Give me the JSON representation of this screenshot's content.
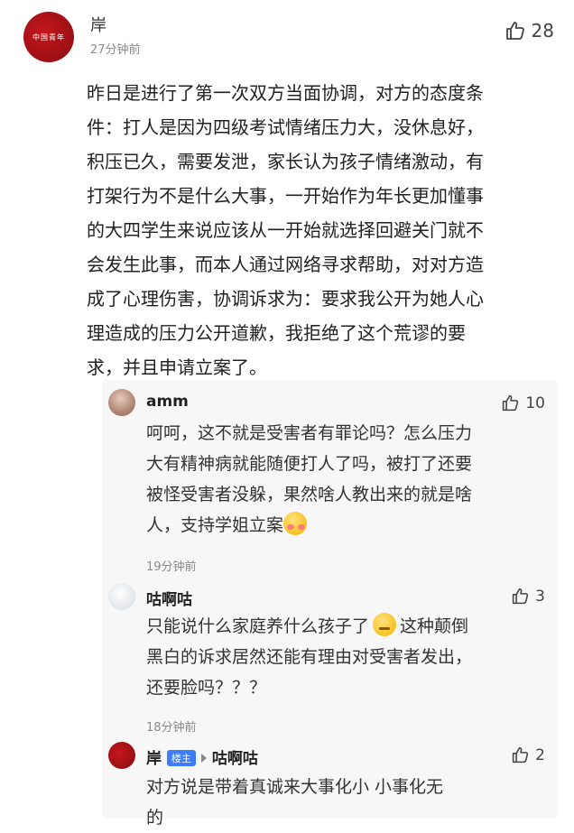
{
  "post": {
    "avatar_text": "中国青年",
    "author": "岸",
    "time": "27分钟前",
    "likes": "28",
    "lines": [
      "昨日是进行了第一次双方当面协调，对方的态度条",
      "件：打人是因为四级考试情绪压力大，没休息好，",
      "积压已久，需要发泄，家长认为孩子情绪激动，有",
      "打架行为不是什么大事，一开始作为年长更加懂事",
      "的大四学生来说应该从一开始就选择回避关门就不",
      "会发生此事，而本人通过网络寻求帮助，对对方造",
      "成了心理伤害，协调诉求为：要求我公开为她人心",
      "理造成的压力公开道歉，我拒绝了这个荒谬的要",
      "求，并且申请立案了。"
    ]
  },
  "replies": [
    {
      "author": "amm",
      "likes": "10",
      "lines": [
        "呵呵，这不就是受害者有罪论吗？怎么压力",
        "大有精神病就能随便打人了吗，被打了还要",
        "被怪受害者没躲，果然啥人教出来的就是啥",
        "人，支持学姐立案"
      ],
      "time": "19分钟前"
    },
    {
      "author": "咕啊咕",
      "likes": "3",
      "lines": [
        "只能说什么家庭养什么孩子了",
        "这种颠倒",
        "黑白的诉求居然还能有理由对受害者发出，",
        "还要脸吗？？？"
      ],
      "time": "18分钟前"
    },
    {
      "author": "岸",
      "badge": "楼主",
      "reply_to": "咕啊咕",
      "likes": "2",
      "lines": [
        "对方说是带着真诚来大事化小 小事化无",
        "的"
      ]
    }
  ]
}
